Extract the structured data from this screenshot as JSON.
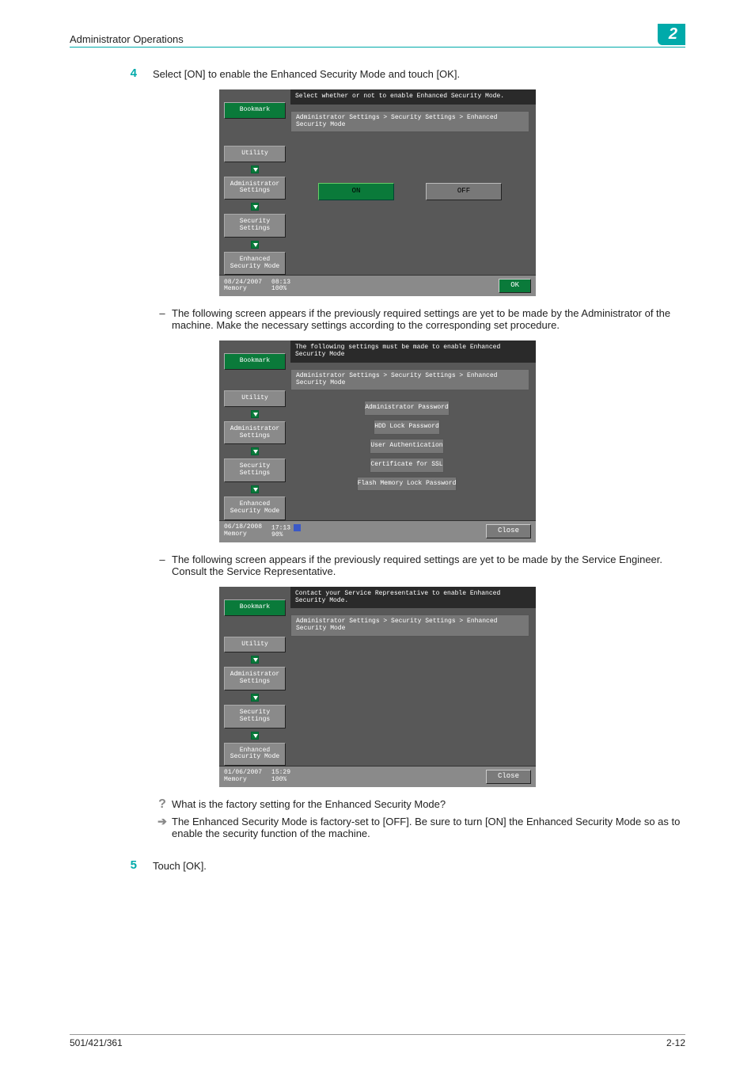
{
  "header": {
    "title": "Administrator Operations",
    "chapter": "2"
  },
  "step4": {
    "num": "4",
    "text": "Select [ON] to enable the Enhanced Security Mode and touch [OK]."
  },
  "screen1": {
    "msg": "Select whether or not to enable Enhanced Security Mode.",
    "path": "Administrator Settings > Security Settings > Enhanced Security Mode",
    "bookmark": "Bookmark",
    "nav": [
      "Utility",
      "Administrator\nSettings",
      "Security\nSettings",
      "Enhanced\nSecurity Mode"
    ],
    "on": "ON",
    "off": "OFF",
    "status": {
      "date": "08/24/2007",
      "time": "08:13",
      "memLabel": "Memory",
      "mem": "100%"
    },
    "ok": "OK"
  },
  "bullet1": "The following screen appears if the previously required settings are yet to be made by the Administrator of the machine. Make the necessary settings according to the corresponding set procedure.",
  "screen2": {
    "msg": "The following settings must be made to enable Enhanced Security Mode",
    "path": "Administrator Settings > Security Settings > Enhanced Security Mode",
    "bookmark": "Bookmark",
    "nav": [
      "Utility",
      "Administrator\nSettings",
      "Security\nSettings",
      "Enhanced\nSecurity Mode"
    ],
    "items": [
      "Administrator Password",
      "HDD Lock Password",
      "User Authentication",
      "Certificate for SSL",
      "Flash Memory Lock Password"
    ],
    "status": {
      "date": "06/18/2008",
      "time": "17:13",
      "memLabel": "Memory",
      "mem": "90%"
    },
    "close": "Close"
  },
  "bullet2": "The following screen appears if the previously required settings are yet to be made by the Service Engineer. Consult the Service Representative.",
  "screen3": {
    "msg": "Contact your Service Representative to enable Enhanced Security Mode.",
    "path": "Administrator Settings > Security Settings > Enhanced Security Mode",
    "bookmark": "Bookmark",
    "nav": [
      "Utility",
      "Administrator\nSettings",
      "Security\nSettings",
      "Enhanced\nSecurity Mode"
    ],
    "status": {
      "date": "01/06/2007",
      "time": "15:29",
      "memLabel": "Memory",
      "mem": "100%"
    },
    "close": "Close"
  },
  "qa": {
    "q": "What is the factory setting for the Enhanced Security Mode?",
    "a": "The Enhanced Security Mode is factory-set to [OFF]. Be sure to turn [ON] the Enhanced Security Mode so as to enable the security function of the machine."
  },
  "step5": {
    "num": "5",
    "text": "Touch [OK]."
  },
  "footer": {
    "left": "501/421/361",
    "right": "2-12"
  }
}
